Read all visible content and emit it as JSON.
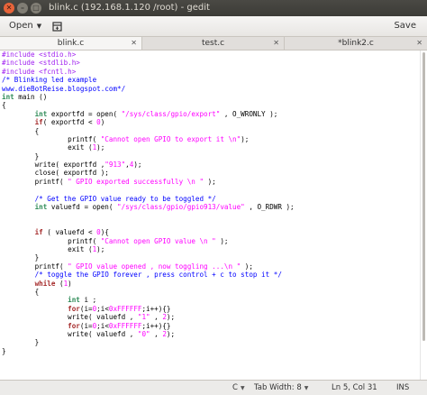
{
  "window": {
    "title": "blink.c (192.168.1.120 /root) - gedit"
  },
  "header": {
    "open_label": "Open",
    "save_label": "Save"
  },
  "tabs": [
    {
      "label": "blink.c",
      "active": true
    },
    {
      "label": "test.c",
      "active": false
    },
    {
      "label": "*blink2.c",
      "active": false
    }
  ],
  "code_lines": [
    [
      {
        "t": "#include <stdio.h>",
        "c": "pp"
      }
    ],
    [
      {
        "t": "#include <stdlib.h>",
        "c": "pp"
      }
    ],
    [
      {
        "t": "#include <fcntl.h>",
        "c": "pp"
      }
    ],
    [
      {
        "t": "/* Blinking led example",
        "c": "cm"
      }
    ],
    [
      {
        "t": "www.dieBotReise.blogspot.com*/",
        "c": "cm"
      }
    ],
    [
      {
        "t": "int",
        "c": "ty"
      },
      {
        "t": " main ()",
        "c": ""
      }
    ],
    [
      {
        "t": "{",
        "c": ""
      }
    ],
    [
      {
        "t": "        ",
        "c": ""
      },
      {
        "t": "int",
        "c": "ty"
      },
      {
        "t": " exportfd = open( ",
        "c": ""
      },
      {
        "t": "\"/sys/class/gpio/export\"",
        "c": "st"
      },
      {
        "t": " , O_WRONLY );",
        "c": ""
      }
    ],
    [
      {
        "t": "        ",
        "c": ""
      },
      {
        "t": "if",
        "c": "kw"
      },
      {
        "t": "( exportfd < ",
        "c": ""
      },
      {
        "t": "0",
        "c": "nm"
      },
      {
        "t": ")",
        "c": ""
      }
    ],
    [
      {
        "t": "        {",
        "c": ""
      }
    ],
    [
      {
        "t": "                printf( ",
        "c": ""
      },
      {
        "t": "\"Cannot open GPIO to export it \\n\"",
        "c": "st"
      },
      {
        "t": ");",
        "c": ""
      }
    ],
    [
      {
        "t": "                exit (",
        "c": ""
      },
      {
        "t": "1",
        "c": "nm"
      },
      {
        "t": ");",
        "c": ""
      }
    ],
    [
      {
        "t": "        }",
        "c": ""
      }
    ],
    [
      {
        "t": "        write( exportfd ,",
        "c": ""
      },
      {
        "t": "\"913\"",
        "c": "st"
      },
      {
        "t": ",",
        "c": ""
      },
      {
        "t": "4",
        "c": "nm"
      },
      {
        "t": ");",
        "c": ""
      }
    ],
    [
      {
        "t": "        close( exportfd );",
        "c": ""
      }
    ],
    [
      {
        "t": "        printf( ",
        "c": ""
      },
      {
        "t": "\" GPIO exported successfully \\n \"",
        "c": "st"
      },
      {
        "t": " );",
        "c": ""
      }
    ],
    [
      {
        "t": "",
        "c": ""
      }
    ],
    [
      {
        "t": "        ",
        "c": ""
      },
      {
        "t": "/* Get the GPIO value ready to be toggled */",
        "c": "cm"
      }
    ],
    [
      {
        "t": "        ",
        "c": ""
      },
      {
        "t": "int",
        "c": "ty"
      },
      {
        "t": " valuefd = open( ",
        "c": ""
      },
      {
        "t": "\"/sys/class/gpio/gpio913/value\"",
        "c": "st"
      },
      {
        "t": " , O_RDWR );",
        "c": ""
      }
    ],
    [
      {
        "t": "",
        "c": ""
      }
    ],
    [
      {
        "t": "",
        "c": ""
      }
    ],
    [
      {
        "t": "        ",
        "c": ""
      },
      {
        "t": "if",
        "c": "kw"
      },
      {
        "t": " ( valuefd < ",
        "c": ""
      },
      {
        "t": "0",
        "c": "nm"
      },
      {
        "t": "){",
        "c": ""
      }
    ],
    [
      {
        "t": "                printf( ",
        "c": ""
      },
      {
        "t": "\"Cannot open GPIO value \\n \"",
        "c": "st"
      },
      {
        "t": " );",
        "c": ""
      }
    ],
    [
      {
        "t": "                exit (",
        "c": ""
      },
      {
        "t": "1",
        "c": "nm"
      },
      {
        "t": ");",
        "c": ""
      }
    ],
    [
      {
        "t": "        }",
        "c": ""
      }
    ],
    [
      {
        "t": "        printf( ",
        "c": ""
      },
      {
        "t": "\" GPIO value opened , now toggling ...\\n \"",
        "c": "st"
      },
      {
        "t": " );",
        "c": ""
      }
    ],
    [
      {
        "t": "        ",
        "c": ""
      },
      {
        "t": "/* toggle the GPIO forever , press control + c to stop it */",
        "c": "cm"
      }
    ],
    [
      {
        "t": "        ",
        "c": ""
      },
      {
        "t": "while",
        "c": "kw"
      },
      {
        "t": " (",
        "c": ""
      },
      {
        "t": "1",
        "c": "nm"
      },
      {
        "t": ")",
        "c": ""
      }
    ],
    [
      {
        "t": "        {",
        "c": ""
      }
    ],
    [
      {
        "t": "                ",
        "c": ""
      },
      {
        "t": "int",
        "c": "ty"
      },
      {
        "t": " i ;",
        "c": ""
      }
    ],
    [
      {
        "t": "                ",
        "c": ""
      },
      {
        "t": "for",
        "c": "kw"
      },
      {
        "t": "(i=",
        "c": ""
      },
      {
        "t": "0",
        "c": "nm"
      },
      {
        "t": ";i<",
        "c": ""
      },
      {
        "t": "0xFFFFFF",
        "c": "nm"
      },
      {
        "t": ";i++){}",
        "c": ""
      }
    ],
    [
      {
        "t": "                write( valuefd , ",
        "c": ""
      },
      {
        "t": "\"1\"",
        "c": "st"
      },
      {
        "t": " , ",
        "c": ""
      },
      {
        "t": "2",
        "c": "nm"
      },
      {
        "t": ");",
        "c": ""
      }
    ],
    [
      {
        "t": "                ",
        "c": ""
      },
      {
        "t": "for",
        "c": "kw"
      },
      {
        "t": "(i=",
        "c": ""
      },
      {
        "t": "0",
        "c": "nm"
      },
      {
        "t": ";i<",
        "c": ""
      },
      {
        "t": "0xFFFFFF",
        "c": "nm"
      },
      {
        "t": ";i++){}",
        "c": ""
      }
    ],
    [
      {
        "t": "                write( valuefd , ",
        "c": ""
      },
      {
        "t": "\"0\"",
        "c": "st"
      },
      {
        "t": " , ",
        "c": ""
      },
      {
        "t": "2",
        "c": "nm"
      },
      {
        "t": ");",
        "c": ""
      }
    ],
    [
      {
        "t": "        }",
        "c": ""
      }
    ],
    [
      {
        "t": "}",
        "c": ""
      }
    ]
  ],
  "status": {
    "language": "C",
    "tab_width": "Tab Width: 8",
    "cursor_position": "Ln 5, Col 31",
    "mode": "INS"
  },
  "colors": {
    "preprocessor": "#a020f0",
    "comment": "#0000ff",
    "string": "#ff00ff",
    "type": "#2e8b57",
    "keyword": "#a52a2a"
  }
}
